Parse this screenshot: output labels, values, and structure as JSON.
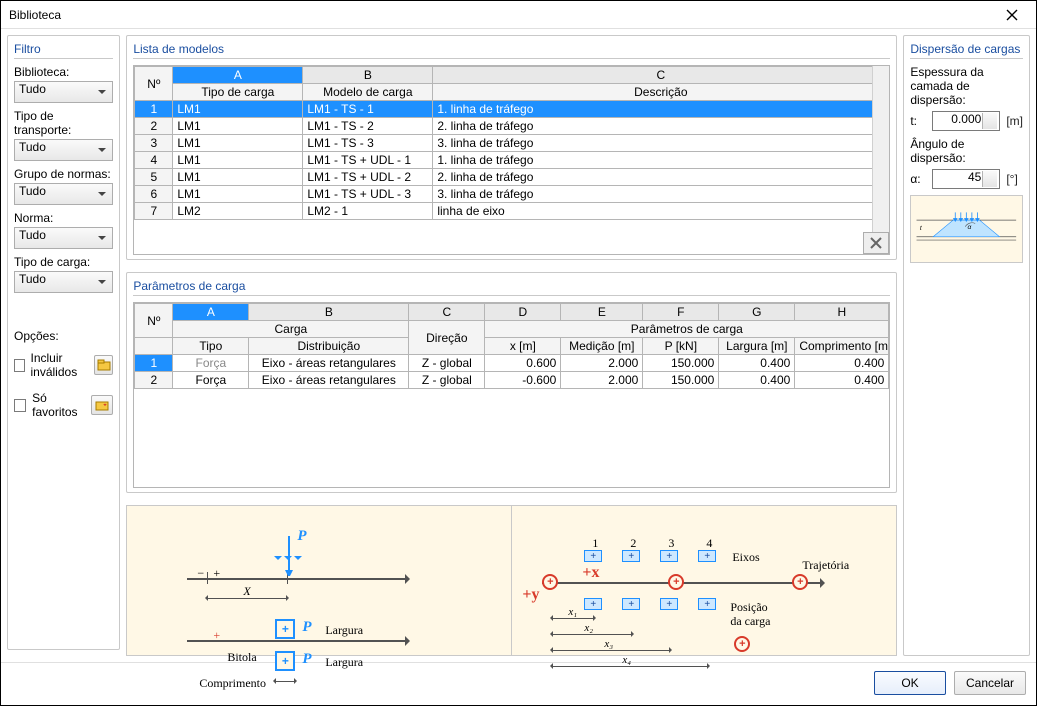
{
  "window": {
    "title": "Biblioteca"
  },
  "filter": {
    "title": "Filtro",
    "biblioteca_label": "Biblioteca:",
    "biblioteca_value": "Tudo",
    "tipo_transporte_label": "Tipo de transporte:",
    "tipo_transporte_value": "Tudo",
    "grupo_normas_label": "Grupo de normas:",
    "grupo_normas_value": "Tudo",
    "norma_label": "Norma:",
    "norma_value": "Tudo",
    "tipo_carga_label": "Tipo de carga:",
    "tipo_carga_value": "Tudo",
    "opcoes_label": "Opções:",
    "incluir_invalidos": "Incluir inválidos",
    "so_favoritos": "Só favoritos"
  },
  "models": {
    "title": "Lista de modelos",
    "colLetters": [
      "A",
      "B",
      "C"
    ],
    "numHeader": "Nº",
    "headers": {
      "tipo": "Tipo de carga",
      "modelo": "Modelo de carga",
      "desc": "Descrição"
    },
    "rows": [
      {
        "n": "1",
        "tipo": "LM1",
        "modelo": "LM1 - TS - 1",
        "desc": "1. linha de tráfego",
        "sel": true
      },
      {
        "n": "2",
        "tipo": "LM1",
        "modelo": "LM1 - TS - 2",
        "desc": "2. linha de tráfego"
      },
      {
        "n": "3",
        "tipo": "LM1",
        "modelo": "LM1 - TS - 3",
        "desc": "3. linha de tráfego"
      },
      {
        "n": "4",
        "tipo": "LM1",
        "modelo": "LM1 - TS + UDL - 1",
        "desc": "1. linha de tráfego"
      },
      {
        "n": "5",
        "tipo": "LM1",
        "modelo": "LM1 - TS + UDL - 2",
        "desc": "2. linha de tráfego"
      },
      {
        "n": "6",
        "tipo": "LM1",
        "modelo": "LM1 - TS + UDL - 3",
        "desc": "3. linha de tráfego"
      },
      {
        "n": "7",
        "tipo": "LM2",
        "modelo": "LM2 - 1",
        "desc": "linha de eixo"
      }
    ]
  },
  "params": {
    "title": "Parâmetros de carga",
    "numHeader": "Nº",
    "colLetters": [
      "A",
      "B",
      "C",
      "D",
      "E",
      "F",
      "G",
      "H"
    ],
    "group1": "Carga",
    "group2": "Parâmetros de carga",
    "headers": {
      "tipo": "Tipo",
      "dist": "Distribuição",
      "dir": "Direção",
      "x": "x [m]",
      "med": "Medição [m]",
      "p": "P [kN]",
      "larg": "Largura [m]",
      "comp": "Comprimento [m]"
    },
    "rows": [
      {
        "n": "1",
        "tipo": "Força",
        "dist": "Eixo - áreas retangulares",
        "dir": "Z - global",
        "x": "0.600",
        "med": "2.000",
        "p": "150.000",
        "larg": "0.400",
        "comp": "0.400",
        "sel": true
      },
      {
        "n": "2",
        "tipo": "Força",
        "dist": "Eixo - áreas retangulares",
        "dir": "Z - global",
        "x": "-0.600",
        "med": "2.000",
        "p": "150.000",
        "larg": "0.400",
        "comp": "0.400"
      }
    ]
  },
  "dispersion": {
    "title": "Dispersão de cargas",
    "thickness_label": "Espessura da camada de dispersão:",
    "t_label": "t:",
    "t_value": "0.000",
    "t_unit": "[m]",
    "angle_label": "Ângulo de dispersão:",
    "alpha_label": "α:",
    "alpha_value": "45",
    "alpha_unit": "[°]"
  },
  "diagram": {
    "P": "P",
    "X": "X",
    "Largura": "Largura",
    "Bitola": "Bitola",
    "Comprimento": "Comprimento",
    "plus_x": "+x",
    "plus_y": "+y",
    "Eixos": "Eixos",
    "Trajetoria": "Trajetória",
    "Posicao1": "Posição",
    "Posicao2": "da carga",
    "axes": [
      "1",
      "2",
      "3",
      "4"
    ],
    "xdims": [
      "x₁",
      "x₂",
      "x₃",
      "x₄"
    ]
  },
  "buttons": {
    "ok": "OK",
    "cancel": "Cancelar"
  },
  "chart_data": {
    "type": "table",
    "title": "Lista de modelos / Parâmetros de carga",
    "models": [
      {
        "n": 1,
        "tipo_carga": "LM1",
        "modelo": "LM1 - TS - 1",
        "descricao": "1. linha de tráfego"
      },
      {
        "n": 2,
        "tipo_carga": "LM1",
        "modelo": "LM1 - TS - 2",
        "descricao": "2. linha de tráfego"
      },
      {
        "n": 3,
        "tipo_carga": "LM1",
        "modelo": "LM1 - TS - 3",
        "descricao": "3. linha de tráfego"
      },
      {
        "n": 4,
        "tipo_carga": "LM1",
        "modelo": "LM1 - TS + UDL - 1",
        "descricao": "1. linha de tráfego"
      },
      {
        "n": 5,
        "tipo_carga": "LM1",
        "modelo": "LM1 - TS + UDL - 2",
        "descricao": "2. linha de tráfego"
      },
      {
        "n": 6,
        "tipo_carga": "LM1",
        "modelo": "LM1 - TS + UDL - 3",
        "descricao": "3. linha de tráfego"
      },
      {
        "n": 7,
        "tipo_carga": "LM2",
        "modelo": "LM2 - 1",
        "descricao": "linha de eixo"
      }
    ],
    "params": [
      {
        "n": 1,
        "tipo": "Força",
        "distribuicao": "Eixo - áreas retangulares",
        "direcao": "Z - global",
        "x_m": 0.6,
        "medicao_m": 2.0,
        "P_kN": 150.0,
        "largura_m": 0.4,
        "comprimento_m": 0.4
      },
      {
        "n": 2,
        "tipo": "Força",
        "distribuicao": "Eixo - áreas retangulares",
        "direcao": "Z - global",
        "x_m": -0.6,
        "medicao_m": 2.0,
        "P_kN": 150.0,
        "largura_m": 0.4,
        "comprimento_m": 0.4
      }
    ],
    "dispersion": {
      "t_m": 0.0,
      "alpha_deg": 45
    }
  }
}
